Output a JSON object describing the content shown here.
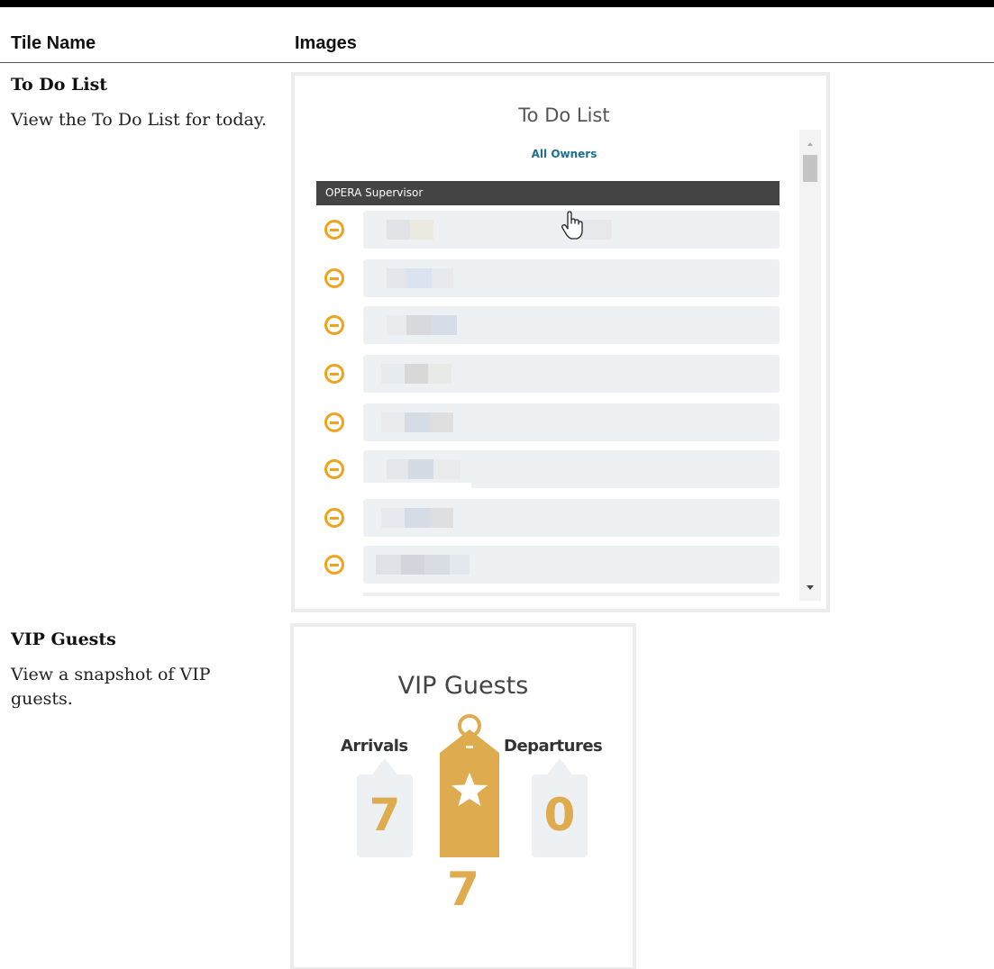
{
  "table": {
    "headers": {
      "tile_name": "Tile Name",
      "images": "Images"
    },
    "rows": [
      {
        "title": "To Do List",
        "description": "View the To Do List for today."
      },
      {
        "title": "VIP Guests",
        "description": "View a snapshot of VIP guests."
      }
    ]
  },
  "todo_tile": {
    "title": "To Do List",
    "filter": "All Owners",
    "group": "OPERA Supervisor",
    "item_icon": "minus-circle-icon",
    "item_count": 8,
    "accent_color": "#f2a21b"
  },
  "vip_tile": {
    "title": "VIP Guests",
    "arrivals_label": "Arrivals",
    "arrivals_value": "7",
    "departures_label": "Departures",
    "departures_value": "0",
    "total_value": "7",
    "tag_icon": "star-tag-icon",
    "accent_color": "#deac4e"
  }
}
